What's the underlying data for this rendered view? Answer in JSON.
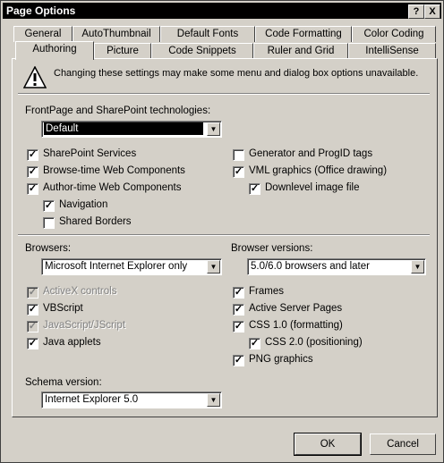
{
  "window": {
    "title": "Page Options"
  },
  "title_buttons": {
    "help": "?",
    "close": "X"
  },
  "tabs_back": [
    "General",
    "AutoThumbnail",
    "Default Fonts",
    "Code Formatting",
    "Color Coding"
  ],
  "tabs_front": [
    "Authoring",
    "Picture",
    "Code Snippets",
    "Ruler and Grid",
    "IntelliSense"
  ],
  "active_tab": "Authoring",
  "warning": {
    "icon": "warning-icon",
    "text": "Changing these settings may make some menu and dialog box options unavailable."
  },
  "frontpage": {
    "label": "FrontPage and SharePoint technologies:",
    "selected": "Default"
  },
  "left_options": [
    {
      "label": "SharePoint Services",
      "checked": true,
      "disabled": false,
      "indent": 0
    },
    {
      "label": "Browse-time Web Components",
      "checked": true,
      "disabled": false,
      "indent": 0
    },
    {
      "label": "Author-time Web Components",
      "checked": true,
      "disabled": false,
      "indent": 0
    },
    {
      "label": "Navigation",
      "checked": true,
      "disabled": false,
      "indent": 1
    },
    {
      "label": "Shared Borders",
      "checked": false,
      "disabled": false,
      "indent": 1
    }
  ],
  "right_options": [
    {
      "label": "Generator and ProgID tags",
      "checked": false,
      "disabled": false,
      "indent": 0
    },
    {
      "label": "VML graphics (Office drawing)",
      "checked": true,
      "disabled": false,
      "indent": 0
    },
    {
      "label": "Downlevel image file",
      "checked": true,
      "disabled": false,
      "indent": 1
    }
  ],
  "browsers": {
    "label": "Browsers:",
    "selected": "Microsoft Internet Explorer only"
  },
  "browser_versions": {
    "label": "Browser versions:",
    "selected": "5.0/6.0 browsers and later"
  },
  "browser_left": [
    {
      "label": "ActiveX controls",
      "checked": true,
      "disabled": true,
      "indent": 0
    },
    {
      "label": "VBScript",
      "checked": true,
      "disabled": false,
      "indent": 0
    },
    {
      "label": "JavaScript/JScript",
      "checked": true,
      "disabled": true,
      "indent": 0
    },
    {
      "label": "Java applets",
      "checked": true,
      "disabled": false,
      "indent": 0
    }
  ],
  "browser_right": [
    {
      "label": "Frames",
      "checked": true,
      "disabled": false,
      "indent": 0
    },
    {
      "label": "Active Server Pages",
      "checked": true,
      "disabled": false,
      "indent": 0
    },
    {
      "label": "CSS 1.0  (formatting)",
      "checked": true,
      "disabled": false,
      "indent": 0
    },
    {
      "label": "CSS 2.0  (positioning)",
      "checked": true,
      "disabled": false,
      "indent": 1
    },
    {
      "label": "PNG graphics",
      "checked": true,
      "disabled": false,
      "indent": 0
    }
  ],
  "schema": {
    "label": "Schema version:",
    "selected": "Internet Explorer 5.0"
  },
  "buttons": {
    "ok": "OK",
    "cancel": "Cancel"
  }
}
